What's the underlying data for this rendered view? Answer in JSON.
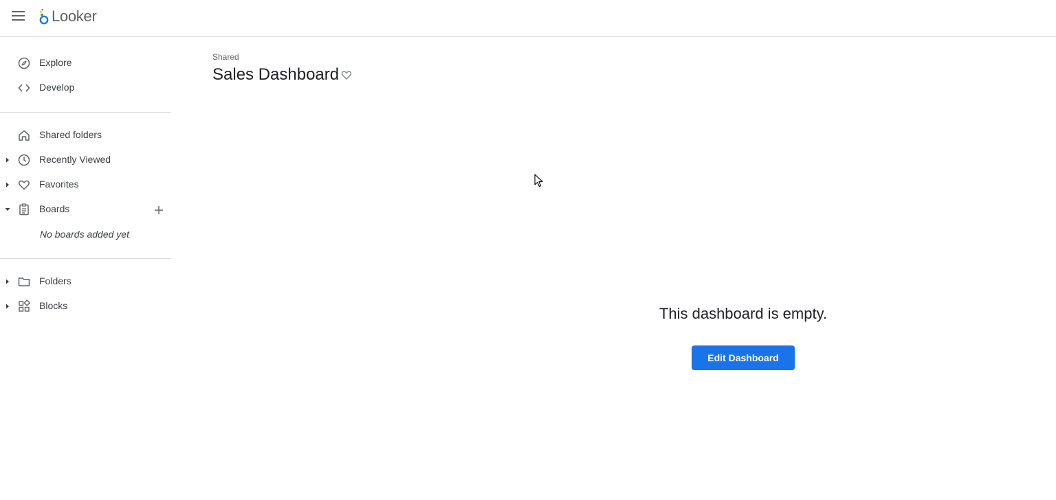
{
  "app": {
    "name": "Looker",
    "brand_colors": {
      "accent": "#1a73e8",
      "text": "#3c4043",
      "muted": "#5f6368",
      "divider": "#dadce0"
    }
  },
  "header": {
    "menu_icon": "hamburger-icon",
    "logo_text": "Looker"
  },
  "sidebar": {
    "primary": [
      {
        "label": "Explore",
        "icon": "compass-icon"
      },
      {
        "label": "Develop",
        "icon": "code-icon"
      }
    ],
    "secondary": [
      {
        "label": "Shared folders",
        "icon": "home-icon",
        "expandable": false
      },
      {
        "label": "Recently Viewed",
        "icon": "clock-icon",
        "expandable": true,
        "expanded": false
      },
      {
        "label": "Favorites",
        "icon": "heart-icon",
        "expandable": true,
        "expanded": false
      },
      {
        "label": "Boards",
        "icon": "clipboard-icon",
        "expandable": true,
        "expanded": true,
        "add_icon": "plus-icon"
      }
    ],
    "boards_empty_text": "No boards added yet",
    "tertiary": [
      {
        "label": "Folders",
        "icon": "folder-icon",
        "expandable": true,
        "expanded": false
      },
      {
        "label": "Blocks",
        "icon": "blocks-icon",
        "expandable": true,
        "expanded": false
      }
    ]
  },
  "main": {
    "breadcrumb": "Shared",
    "title": "Sales Dashboard",
    "favorite_icon": "heart-outline-icon",
    "empty_message": "This dashboard is empty.",
    "edit_button_label": "Edit Dashboard"
  }
}
